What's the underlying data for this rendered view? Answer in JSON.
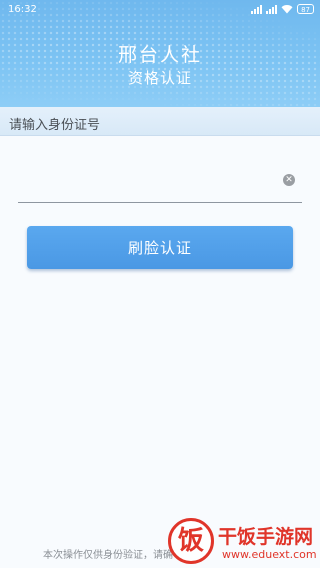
{
  "status_bar": {
    "time": "16:32",
    "battery": "87"
  },
  "header": {
    "title": "邢台人社",
    "subtitle": "资格认证"
  },
  "form": {
    "id_label": "请输入身份证号",
    "id_value": "",
    "clear_icon": "close-circle-icon",
    "clear_glyph": "✕",
    "submit_label": "刷脸认证"
  },
  "footer": {
    "note": "本次操作仅供身份验证，请确"
  },
  "watermark": {
    "logo_char": "饭",
    "title": "干饭手游网",
    "url": "www.eduext.com"
  },
  "colors": {
    "header_blue": "#7cc3f3",
    "button_blue": "#4a98e4",
    "watermark_red": "#e0352a"
  }
}
